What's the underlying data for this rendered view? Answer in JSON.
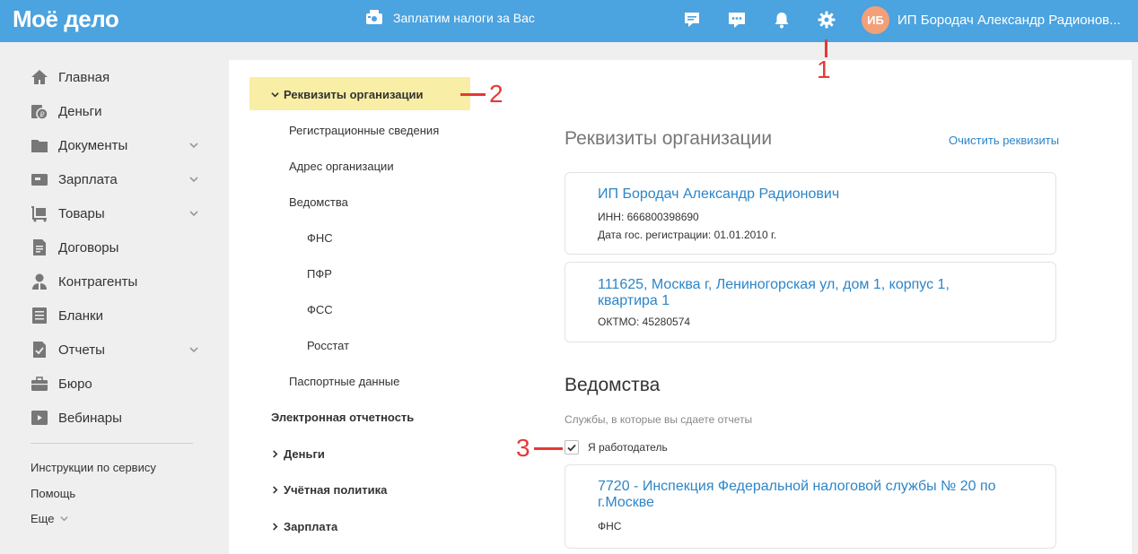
{
  "header": {
    "logo": "Moё дело",
    "promo_text": "Заплатим налоги за Вас",
    "user_initials": "ИБ",
    "user_name": "ИП Бородач Александр Радионов...",
    "icons": [
      "chat-icon",
      "messages-icon",
      "bell-icon",
      "gear-icon"
    ],
    "brand_color": "#4ba3df"
  },
  "sidebar": {
    "items": [
      {
        "label": "Главная",
        "icon": "home-icon",
        "expandable": false
      },
      {
        "label": "Деньги",
        "icon": "money-icon",
        "expandable": false
      },
      {
        "label": "Документы",
        "icon": "folder-icon",
        "expandable": true
      },
      {
        "label": "Зарплата",
        "icon": "wallet-icon",
        "expandable": true
      },
      {
        "label": "Товары",
        "icon": "cart-icon",
        "expandable": true
      },
      {
        "label": "Договоры",
        "icon": "contract-icon",
        "expandable": false
      },
      {
        "label": "Контрагенты",
        "icon": "person-icon",
        "expandable": false
      },
      {
        "label": "Бланки",
        "icon": "forms-icon",
        "expandable": false
      },
      {
        "label": "Отчеты",
        "icon": "report-icon",
        "expandable": true
      },
      {
        "label": "Бюро",
        "icon": "briefcase-icon",
        "expandable": false
      },
      {
        "label": "Вебинары",
        "icon": "video-icon",
        "expandable": false
      }
    ],
    "links": {
      "instructions": "Инструкции по сервису",
      "help": "Помощь",
      "more": "Еще"
    }
  },
  "tree": {
    "active": "Реквизиты организации",
    "registration": "Регистрационные сведения",
    "address": "Адрес организации",
    "departments": "Ведомства",
    "fns": "ФНС",
    "pfr": "ПФР",
    "fss": "ФСС",
    "rosstat": "Росстат",
    "passport": "Паспортные данные",
    "e_reporting": "Электронная отчетность",
    "money": "Деньги",
    "accounting_policy": "Учётная политика",
    "salary": "Зарплата"
  },
  "main": {
    "title": "Реквизиты организации",
    "clear_link": "Очистить реквизиты",
    "org_card": {
      "name": "ИП Бородач Александр Радионович",
      "inn": "ИНН: 666800398690",
      "reg_date": "Дата гос. регистрации: 01.01.2010 г."
    },
    "address_card": {
      "address": "111625, Москва г, Лениногорская ул, дом 1, корпус 1, квартира 1",
      "oktmo": "ОКТМО: 45280574"
    },
    "departments_title": "Ведомства",
    "departments_sub": "Службы, в которые вы сдаете отчеты",
    "employer_label": "Я работодатель",
    "employer_checked": true,
    "fns_card": {
      "name": "7720 - Инспекция Федеральной налоговой службы № 20 по г.Москве",
      "type": "ФНС"
    }
  },
  "annotations": [
    "1",
    "2",
    "3"
  ],
  "annotation_color": "#e53935"
}
